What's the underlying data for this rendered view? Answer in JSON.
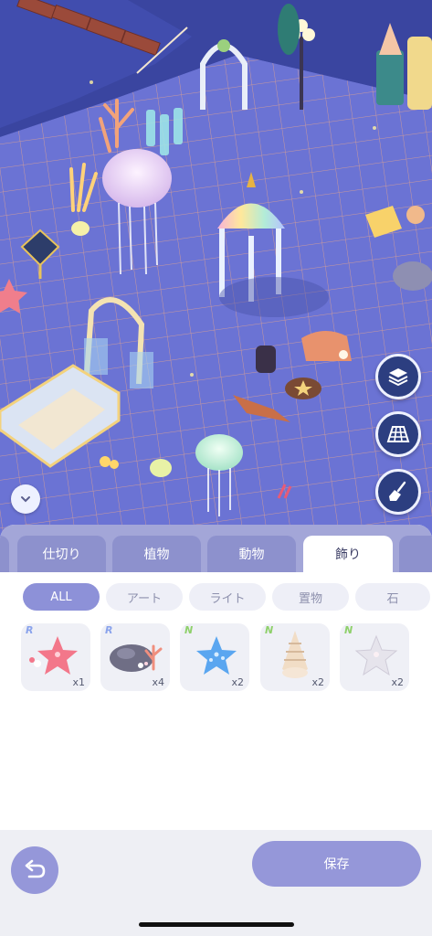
{
  "scene": {
    "colors": {
      "floor": "#6b73d4",
      "grid": "#e9a68a",
      "water": "#3a45a0"
    }
  },
  "side_tools": [
    {
      "name": "layers-icon"
    },
    {
      "name": "grid-icon"
    },
    {
      "name": "broom-icon"
    }
  ],
  "tabs": [
    {
      "label": ""
    },
    {
      "label": "仕切り"
    },
    {
      "label": "植物"
    },
    {
      "label": "動物"
    },
    {
      "label": "飾り",
      "active": true
    },
    {
      "label": ""
    }
  ],
  "filters": [
    {
      "label": "ALL",
      "active": true
    },
    {
      "label": "アート"
    },
    {
      "label": "ライト"
    },
    {
      "label": "置物"
    },
    {
      "label": "石"
    }
  ],
  "items": [
    {
      "rarity": "R",
      "qty": "x1",
      "icon": "red-starfish-icon"
    },
    {
      "rarity": "R",
      "qty": "x4",
      "icon": "coral-rock-icon"
    },
    {
      "rarity": "N",
      "qty": "x2",
      "icon": "blue-starfish-icon"
    },
    {
      "rarity": "N",
      "qty": "x2",
      "icon": "spiral-shell-icon"
    },
    {
      "rarity": "N",
      "qty": "x2",
      "icon": "white-starfish-icon"
    }
  ],
  "footer": {
    "save_label": "保存"
  }
}
